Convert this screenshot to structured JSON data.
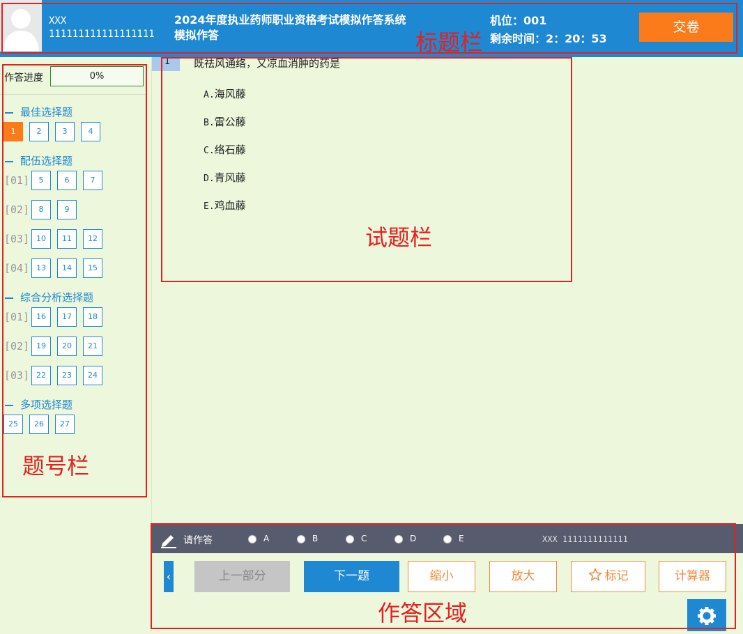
{
  "header": {
    "user_name": "XXX",
    "user_id": "111111111111111111",
    "title_line1": "2024年度执业药师职业资格考试模拟作答系统",
    "title_line2": "模拟作答",
    "seat": "机位：001",
    "timer": "剩余时间：2：20：53",
    "submit_label": "交卷"
  },
  "annotations": {
    "title_bar": "标题栏",
    "question_bar": "试题栏",
    "number_bar": "题号栏",
    "answer_area": "作答区域"
  },
  "sidebar": {
    "progress_label": "作答进度",
    "progress_value": "0%",
    "sections": [
      {
        "title": "最佳选择题",
        "questions": [
          "1",
          "2",
          "3",
          "4"
        ]
      },
      {
        "title": "配伍选择题",
        "groups": [
          {
            "label": "[01]",
            "questions": [
              "5",
              "6",
              "7"
            ]
          },
          {
            "label": "[02]",
            "questions": [
              "8",
              "9"
            ]
          },
          {
            "label": "[03]",
            "questions": [
              "10",
              "11",
              "12"
            ]
          },
          {
            "label": "[04]",
            "questions": [
              "13",
              "14",
              "15"
            ]
          }
        ]
      },
      {
        "title": "综合分析选择题",
        "groups": [
          {
            "label": "[01]",
            "questions": [
              "16",
              "17",
              "18"
            ]
          },
          {
            "label": "[02]",
            "questions": [
              "19",
              "20",
              "21"
            ]
          },
          {
            "label": "[03]",
            "questions": [
              "22",
              "23",
              "24"
            ]
          }
        ]
      },
      {
        "title": "多项选择题",
        "questions": [
          "25",
          "26",
          "27"
        ]
      }
    ]
  },
  "question": {
    "number": "1",
    "stem": "既祛风通络，又凉血消肿的药是",
    "options": [
      {
        "key": "A.",
        "text": "海风藤"
      },
      {
        "key": "B.",
        "text": "雷公藤"
      },
      {
        "key": "C.",
        "text": "络石藤"
      },
      {
        "key": "D.",
        "text": "青风藤"
      },
      {
        "key": "E.",
        "text": "鸡血藤"
      }
    ]
  },
  "answer_bar": {
    "please_answer": "请作答",
    "choices": [
      "A",
      "B",
      "C",
      "D",
      "E"
    ],
    "user_info": "XXX 1111111111111"
  },
  "buttons": {
    "prev_arrow": "‹",
    "prev_part": "上一部分",
    "next_question": "下一题",
    "zoom_out": "缩小",
    "zoom_in": "放大",
    "mark": "标记",
    "calculator": "计算器"
  },
  "colors": {
    "header_blue": "#1e88d2",
    "accent_orange": "#fb7a1a",
    "annotation_red": "#e52020",
    "background": "#edf7dc"
  }
}
